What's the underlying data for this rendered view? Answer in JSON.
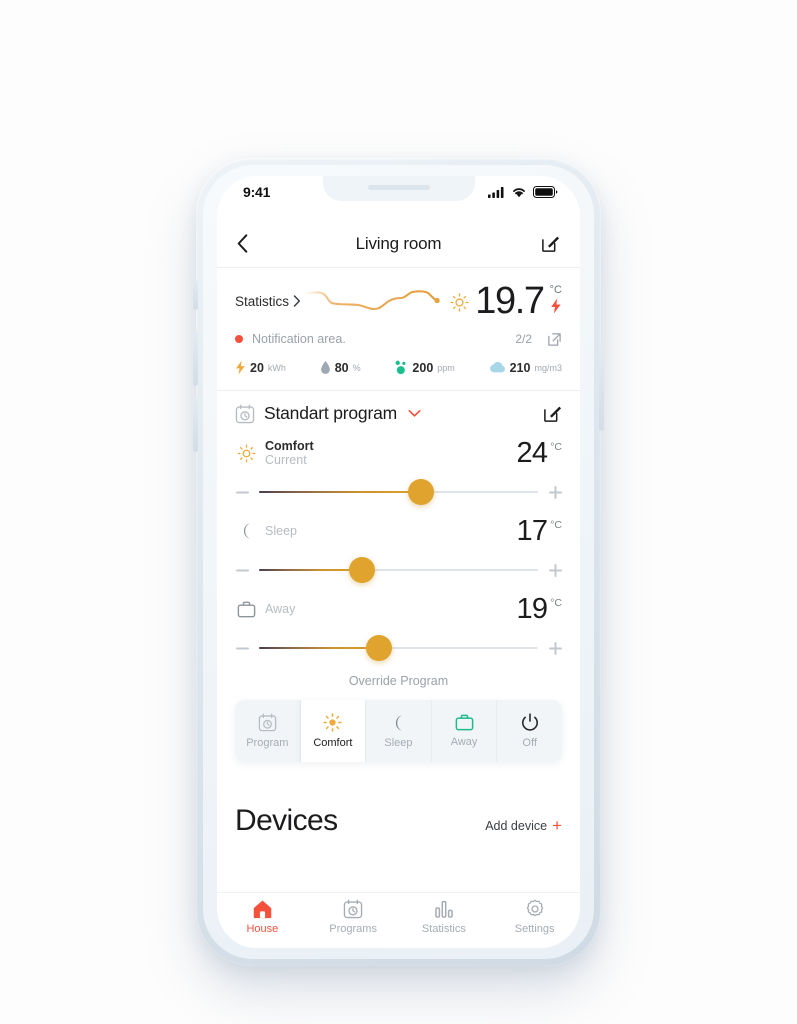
{
  "device": {
    "status_bar": {
      "time": "9:41",
      "cellular_icon": "cellular-signal-icon",
      "wifi_icon": "wifi-icon",
      "battery_icon": "battery-full-icon"
    }
  },
  "nav": {
    "back_icon": "chevron-left-icon",
    "title": "Living room",
    "edit_icon": "edit-pencil-icon"
  },
  "stats": {
    "link_label": "Statistics",
    "link_chevron": "chevron-right-icon",
    "sun_icon": "sun-icon",
    "temperature": "19.7",
    "temperature_unit": "°C",
    "bolt_icon": "lightning-bolt-icon",
    "sparkline_color": "#e59b3a",
    "notification": {
      "dot_color": "#f4513c",
      "text": "Notification area.",
      "count": "2/2",
      "open_icon": "external-link-icon"
    },
    "metrics": [
      {
        "icon": "lightning-bolt-icon",
        "value": "20",
        "unit": "kWh",
        "color": "#f0a93a"
      },
      {
        "icon": "water-drop-icon",
        "value": "80",
        "unit": "%",
        "color": "#9fa9b3"
      },
      {
        "icon": "co2-particles-icon",
        "value": "200",
        "unit": "ppm",
        "color": "#1bbf8e"
      },
      {
        "icon": "cloud-icon",
        "value": "210",
        "unit": "mg/m3",
        "color": "#a8d8e8"
      }
    ]
  },
  "program": {
    "calendar_icon": "calendar-clock-icon",
    "name": "Standart program",
    "caret_icon": "chevron-down-icon",
    "caret_color": "#f4513c",
    "edit_icon": "edit-pencil-icon"
  },
  "modes": [
    {
      "id": "comfort",
      "icon": "sun-icon",
      "icon_color": "#f0a93a",
      "title": "Comfort",
      "subtitle": "Current",
      "temperature": "24",
      "unit": "°C",
      "slider_percent": 58,
      "minus_icon": "minus-icon",
      "plus_icon": "plus-icon"
    },
    {
      "id": "sleep",
      "icon": "moon-icon",
      "icon_color": "#8d949b",
      "title": "Sleep",
      "subtitle": "",
      "temperature": "17",
      "unit": "°C",
      "slider_percent": 37,
      "minus_icon": "minus-icon",
      "plus_icon": "plus-icon"
    },
    {
      "id": "away",
      "icon": "briefcase-icon",
      "icon_color": "#8d949b",
      "title": "Away",
      "subtitle": "",
      "temperature": "19",
      "unit": "°C",
      "slider_percent": 43,
      "minus_icon": "minus-icon",
      "plus_icon": "plus-icon"
    }
  ],
  "override_label": "Override Program",
  "mode_buttons": [
    {
      "id": "program",
      "icon": "calendar-clock-icon",
      "label": "Program",
      "active": false,
      "icon_color": "#b6bcc2"
    },
    {
      "id": "comfort",
      "icon": "sun-icon",
      "label": "Comfort",
      "active": true,
      "icon_color": "#f0a93a"
    },
    {
      "id": "sleep",
      "icon": "moon-icon",
      "label": "Sleep",
      "active": false,
      "icon_color": "#7d848b"
    },
    {
      "id": "away",
      "icon": "briefcase-icon",
      "label": "Away",
      "active": false,
      "icon_color": "#1fb98a"
    },
    {
      "id": "off",
      "icon": "power-icon",
      "label": "Off",
      "active": false,
      "icon_color": "#2c2c2e"
    }
  ],
  "devices": {
    "title": "Devices",
    "add_label": "Add device",
    "add_icon": "plus-icon",
    "add_icon_color": "#f4513c"
  },
  "tab_bar": [
    {
      "id": "house",
      "icon": "home-icon",
      "label": "House",
      "active": true
    },
    {
      "id": "programs",
      "icon": "calendar-clock-icon",
      "label": "Programs",
      "active": false
    },
    {
      "id": "statistics",
      "icon": "bar-chart-icon",
      "label": "Statistics",
      "active": false
    },
    {
      "id": "settings",
      "icon": "gear-icon",
      "label": "Settings",
      "active": false
    }
  ],
  "theme": {
    "accent": "#f4513c",
    "gold": "#dfa32e",
    "green": "#1fb98a",
    "muted": "#a6acb3"
  }
}
